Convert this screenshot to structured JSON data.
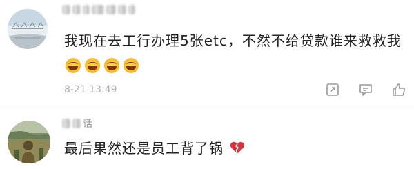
{
  "comments": [
    {
      "username": "",
      "text": "我现在去工行办理5张etc，不然不给贷款谁来救救我",
      "emoji": [
        "laughing-tears",
        "laughing-tears",
        "laughing-tears",
        "laughing-tears"
      ],
      "timestamp": "8-21 13:49",
      "actions": [
        "share-icon",
        "comment-icon",
        "like-icon"
      ]
    },
    {
      "username": "",
      "username_visible": "话",
      "text": "最后果然还是员工背了锅",
      "emoji": [
        "broken-heart"
      ]
    }
  ]
}
